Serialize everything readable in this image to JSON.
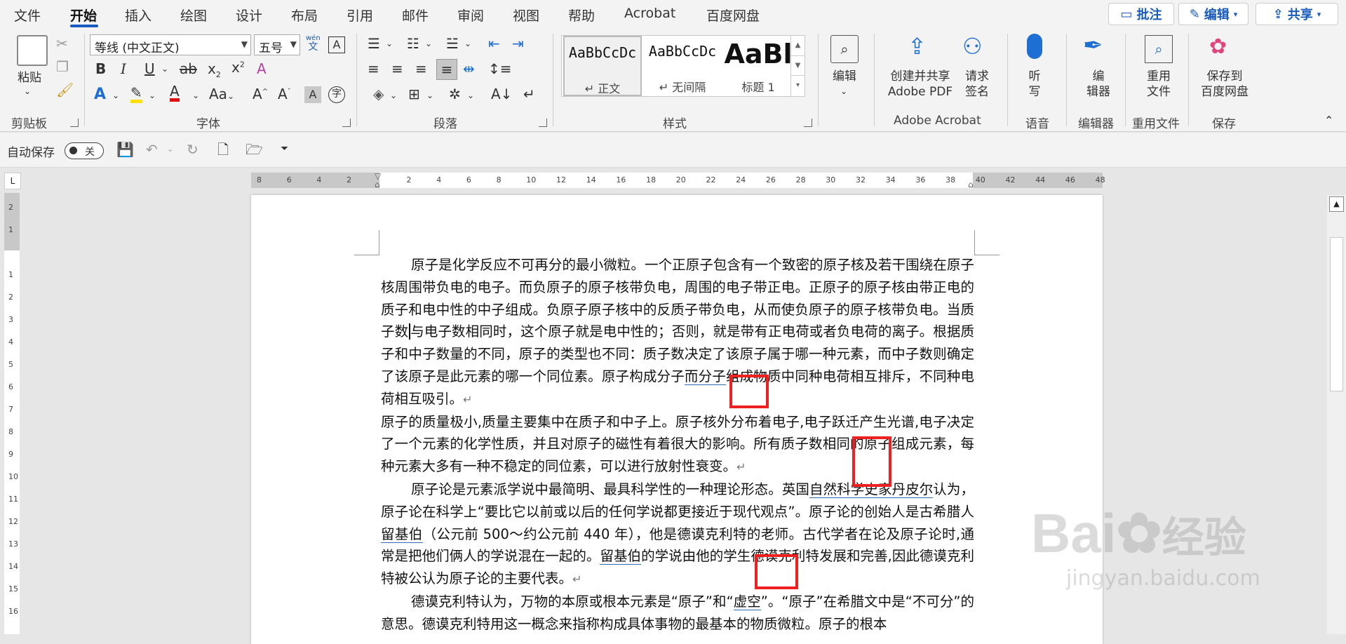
{
  "menu": {
    "tabs": [
      "文件",
      "开始",
      "插入",
      "绘图",
      "设计",
      "布局",
      "引用",
      "邮件",
      "审阅",
      "视图",
      "帮助",
      "Acrobat",
      "百度网盘"
    ],
    "active": "开始",
    "comment": "批注",
    "edit": "编辑",
    "share": "共享"
  },
  "ribbon": {
    "clipboard": {
      "paste": "粘贴",
      "label": "剪贴板"
    },
    "font": {
      "name": "等线 (中文正文)",
      "size": "五号",
      "wen_a": "wén",
      "wen_b": "文",
      "aa": "Aa",
      "label": "字体"
    },
    "paragraph": {
      "label": "段落"
    },
    "styles": {
      "items": [
        {
          "preview": "AaBbCcDc",
          "name": "↵ 正文"
        },
        {
          "preview": "AaBbCcDc",
          "name": "↵ 无间隔"
        },
        {
          "preview": "AaBl",
          "name": "标题 1"
        }
      ],
      "label": "样式"
    },
    "editing": {
      "label": "编辑"
    },
    "acrobat": {
      "create": "创建并共享",
      "create2": "Adobe PDF",
      "request": "请求",
      "request2": "签名",
      "label": "Adobe Acrobat"
    },
    "voice": {
      "listen": "听",
      "listen2": "写",
      "label": "语音"
    },
    "editor": {
      "edit": "编",
      "edit2": "辑器",
      "label": "编辑器"
    },
    "reuse": {
      "reuse": "重用",
      "reuse2": "文件",
      "label": "重用文件"
    },
    "save": {
      "save": "保存到",
      "save2": "百度网盘",
      "label": "保存"
    }
  },
  "qat": {
    "autosave": "自动保存",
    "off": "关"
  },
  "ruler": {
    "h": [
      "8",
      "6",
      "4",
      "2",
      "",
      "2",
      "4",
      "6",
      "8",
      "10",
      "12",
      "14",
      "16",
      "18",
      "20",
      "22",
      "24",
      "26",
      "28",
      "30",
      "32",
      "34",
      "36",
      "38",
      "40",
      "42",
      "44",
      "46",
      "48"
    ],
    "v": [
      "2",
      "1",
      "",
      "1",
      "2",
      "3",
      "4",
      "5",
      "6",
      "7",
      "8",
      "9",
      "10",
      "11",
      "12",
      "13",
      "14",
      "15",
      "16"
    ]
  },
  "doc": {
    "p1a": "原子是化学反应不可再分的最小微粒。一个正原子包含有一个致密的原子核及若干围绕在原子核周围带负电的电子。而负原子的原子核带负电，周围的电子带正电。正原子的原子核由带正电的质子和电中性的中子组成。负原子原子核中的反质子带负电，从而使负原子的原子核带负电。当质子数",
    "p1b": "与电子数相同时，这个原子就是电中性的；否则，就是带有正电荷或者负电荷的离子。根据质子和中子数量的不同，原子的类型也不同：质子数决定了该原子属于哪一种元素，而中子数则确定了该原子是此元素的哪一个同位素。原子构成分子",
    "p1link": "而分子",
    "p1c": "组成物质中同种电荷相互排斥，不同种电荷相互吸引。",
    "p2": "原子的质量极小,质量主要集中在质子和中子上。原子核外分布着电子,电子跃迁产生光谱,电子决定了一个元素的化学性质，并且对原子的磁性有着很大的影响。所有质子数相同的原子组成元素，每种元素大多有一种不稳定的同位素，可以进行放射性衰变。",
    "p3a": "原子论是元素派学说中最简明、最具科学性的一种理论形态。英国",
    "p3link": "自然科学史家丹皮尔",
    "p3b": "认为，原子论在科学上“要比它以前或以后的任何学说都更接近于现代观点”。原子论的创始人是古希腊人",
    "p3link2": "留基伯",
    "p3c": "（公元前 500～约公元前 440 年），他是德谟克利特的老师。古代学者在论及原子论时,通常是把他们俩人的学说混在一起的。",
    "p3link3": "留基伯",
    "p3d": "的学说由他的学生德谟克利特发展和完善,因此德谟克利特被公认为原子论的主要代表。",
    "p4": "德谟克利特认为，万物的本原或根本元素是“原子”和“",
    "p4link": "虚空",
    "p4b": "”。“原子”在希腊文中是“不可分”的意思。德谟克利特用这一概念来指称构成具体事物的最基本的物质微粒。原子的根本",
    "pmark": "↵"
  },
  "watermark": {
    "brand": "Bai",
    "cn": "经验",
    "url": "jingyan.baidu.com"
  }
}
